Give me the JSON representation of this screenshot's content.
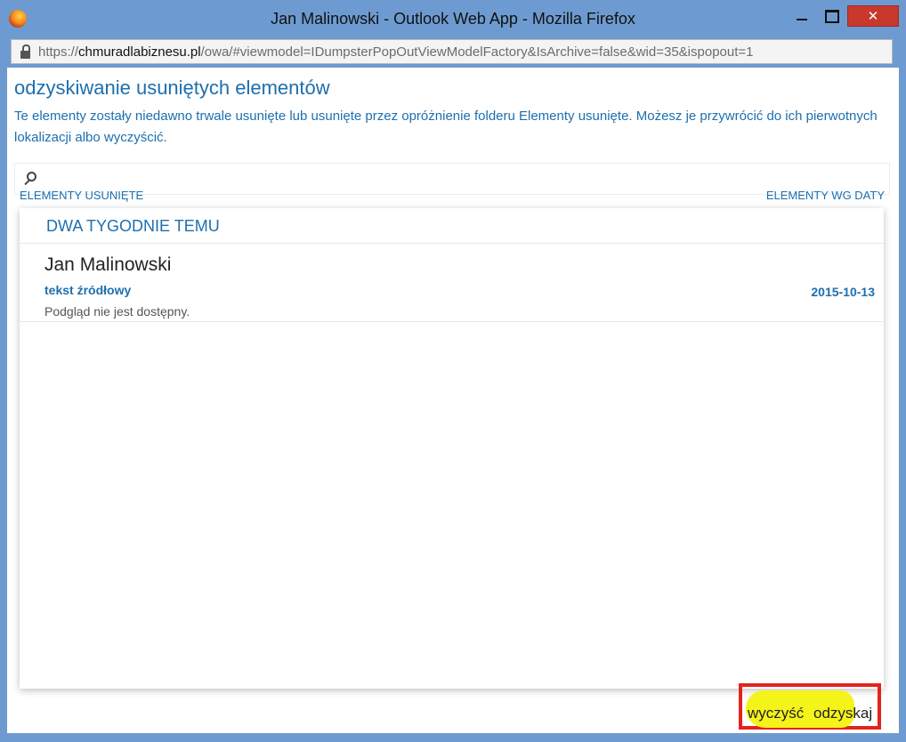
{
  "window": {
    "title": "Jan Malinowski - Outlook Web App - Mozilla Firefox",
    "close_symbol": "✕",
    "url_protocol": "https://",
    "url_host": "chmuradlabiznesu.pl",
    "url_path": "/owa/#viewmodel=IDumpsterPopOutViewModelFactory&IsArchive=false&wid=35&ispopout=1"
  },
  "page": {
    "heading": "odzyskiwanie usuniętych elementów",
    "description": "Te elementy zostały niedawno trwale usunięte lub usunięte przez opróżnienie folderu Elementy usunięte. Możesz je przywrócić do ich pierwotnych lokalizacji albo wyczyścić.",
    "label_left": "ELEMENTY USUNIĘTE",
    "label_right": "ELEMENTY WG DATY"
  },
  "list": {
    "group_header": "DWA TYGODNIE TEMU",
    "items": [
      {
        "sender": "Jan Malinowski",
        "subject": "tekst źródłowy",
        "date": "2015-10-13",
        "preview": "Podgląd nie jest dostępny."
      }
    ]
  },
  "actions": {
    "purge_label": "wyczyść",
    "recover_label": "odzyskaj"
  },
  "colors": {
    "accent": "#1d6fae",
    "highlight_border": "#e4231d",
    "highlight_fill": "#f4f31a"
  }
}
